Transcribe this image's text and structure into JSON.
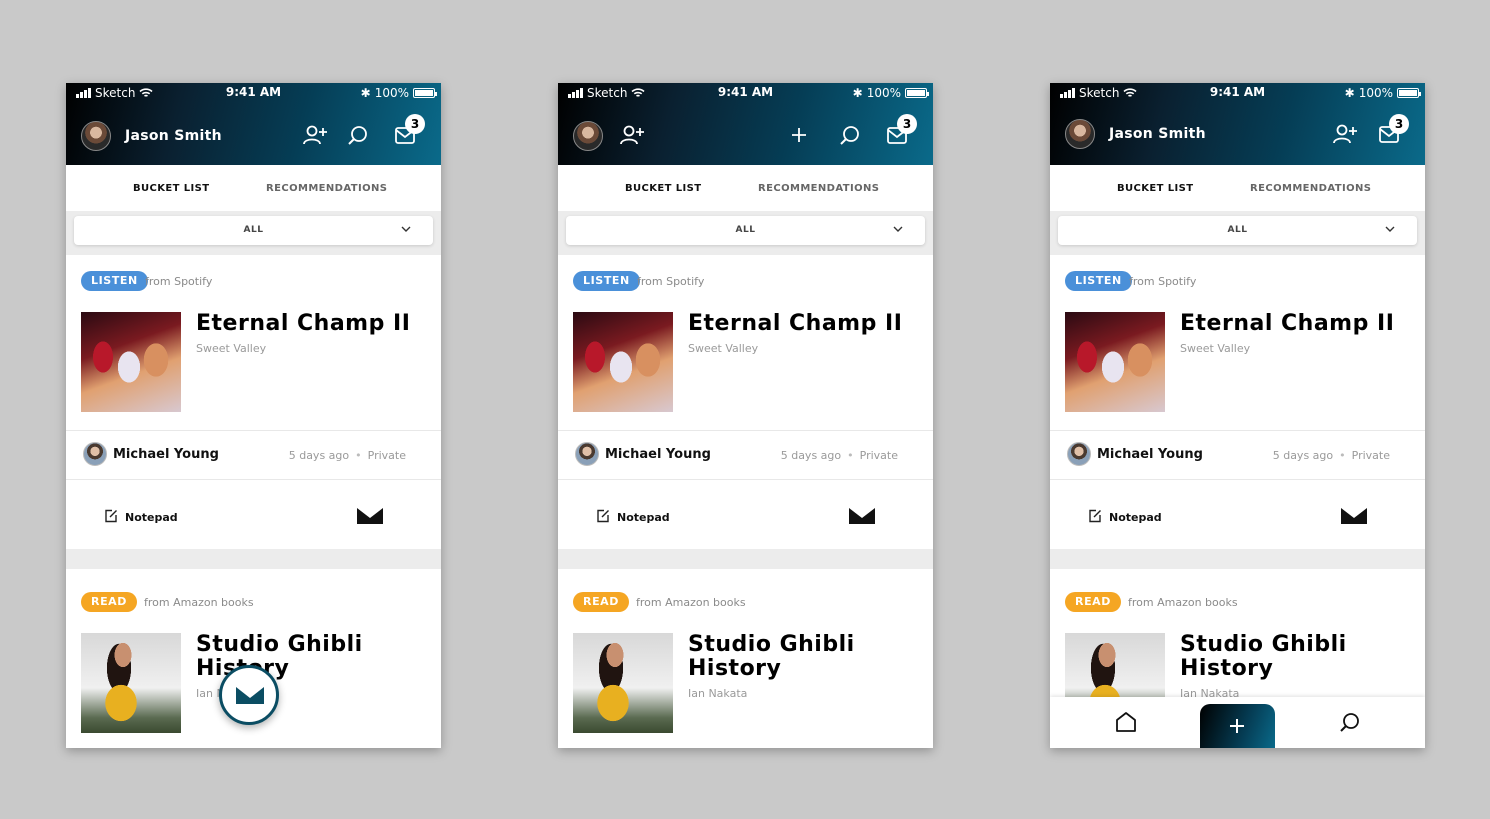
{
  "status": {
    "carrier": "Sketch",
    "time": "9:41 AM",
    "battery": "100%"
  },
  "user": {
    "name": "Jason Smith"
  },
  "inbox": {
    "count": "3"
  },
  "tabs": [
    {
      "label": "BUCKET LIST",
      "active": true
    },
    {
      "label": "RECOMMENDATIONS",
      "active": false
    }
  ],
  "filter": {
    "value": "ALL"
  },
  "items": [
    {
      "type": "LISTEN",
      "source": "from Spotify",
      "title": "Eternal Champ II",
      "subtitle": "Sweet Valley",
      "owner": "Michael Young",
      "time": "5 days ago",
      "visibility": "Private",
      "separator": "•",
      "notepad": "Notepad"
    },
    {
      "type": "READ",
      "source": "from Amazon books",
      "title_line1": "Studio Ghibli",
      "title_line2": "History",
      "subtitle": "Ian Nakata"
    }
  ],
  "icons": {
    "add_user": "add-user-icon",
    "search": "search-icon",
    "mail": "mail-icon",
    "plus": "plus-icon",
    "home": "home-icon",
    "notepad": "notepad-icon",
    "logo": "m-logo-icon"
  },
  "colors": {
    "listen": "#4a90d9",
    "read": "#f5a623",
    "header_accent": "#0a6a8a"
  }
}
